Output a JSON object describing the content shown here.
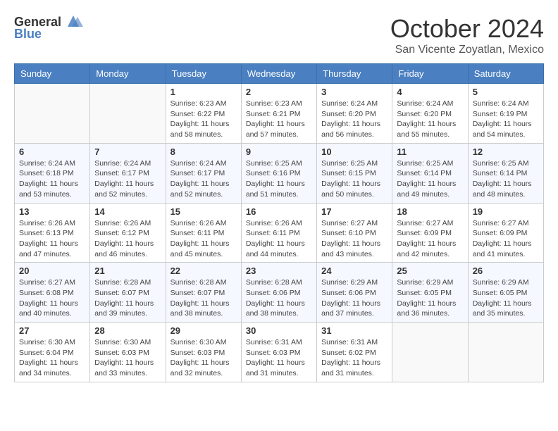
{
  "header": {
    "logo_general": "General",
    "logo_blue": "Blue",
    "month_title": "October 2024",
    "location": "San Vicente Zoyatlan, Mexico"
  },
  "calendar": {
    "days_of_week": [
      "Sunday",
      "Monday",
      "Tuesday",
      "Wednesday",
      "Thursday",
      "Friday",
      "Saturday"
    ],
    "weeks": [
      [
        {
          "day": "",
          "sunrise": "",
          "sunset": "",
          "daylight": "",
          "empty": true
        },
        {
          "day": "",
          "sunrise": "",
          "sunset": "",
          "daylight": "",
          "empty": true
        },
        {
          "day": "1",
          "sunrise": "Sunrise: 6:23 AM",
          "sunset": "Sunset: 6:22 PM",
          "daylight": "Daylight: 11 hours and 58 minutes."
        },
        {
          "day": "2",
          "sunrise": "Sunrise: 6:23 AM",
          "sunset": "Sunset: 6:21 PM",
          "daylight": "Daylight: 11 hours and 57 minutes."
        },
        {
          "day": "3",
          "sunrise": "Sunrise: 6:24 AM",
          "sunset": "Sunset: 6:20 PM",
          "daylight": "Daylight: 11 hours and 56 minutes."
        },
        {
          "day": "4",
          "sunrise": "Sunrise: 6:24 AM",
          "sunset": "Sunset: 6:20 PM",
          "daylight": "Daylight: 11 hours and 55 minutes."
        },
        {
          "day": "5",
          "sunrise": "Sunrise: 6:24 AM",
          "sunset": "Sunset: 6:19 PM",
          "daylight": "Daylight: 11 hours and 54 minutes."
        }
      ],
      [
        {
          "day": "6",
          "sunrise": "Sunrise: 6:24 AM",
          "sunset": "Sunset: 6:18 PM",
          "daylight": "Daylight: 11 hours and 53 minutes."
        },
        {
          "day": "7",
          "sunrise": "Sunrise: 6:24 AM",
          "sunset": "Sunset: 6:17 PM",
          "daylight": "Daylight: 11 hours and 52 minutes."
        },
        {
          "day": "8",
          "sunrise": "Sunrise: 6:24 AM",
          "sunset": "Sunset: 6:17 PM",
          "daylight": "Daylight: 11 hours and 52 minutes."
        },
        {
          "day": "9",
          "sunrise": "Sunrise: 6:25 AM",
          "sunset": "Sunset: 6:16 PM",
          "daylight": "Daylight: 11 hours and 51 minutes."
        },
        {
          "day": "10",
          "sunrise": "Sunrise: 6:25 AM",
          "sunset": "Sunset: 6:15 PM",
          "daylight": "Daylight: 11 hours and 50 minutes."
        },
        {
          "day": "11",
          "sunrise": "Sunrise: 6:25 AM",
          "sunset": "Sunset: 6:14 PM",
          "daylight": "Daylight: 11 hours and 49 minutes."
        },
        {
          "day": "12",
          "sunrise": "Sunrise: 6:25 AM",
          "sunset": "Sunset: 6:14 PM",
          "daylight": "Daylight: 11 hours and 48 minutes."
        }
      ],
      [
        {
          "day": "13",
          "sunrise": "Sunrise: 6:26 AM",
          "sunset": "Sunset: 6:13 PM",
          "daylight": "Daylight: 11 hours and 47 minutes."
        },
        {
          "day": "14",
          "sunrise": "Sunrise: 6:26 AM",
          "sunset": "Sunset: 6:12 PM",
          "daylight": "Daylight: 11 hours and 46 minutes."
        },
        {
          "day": "15",
          "sunrise": "Sunrise: 6:26 AM",
          "sunset": "Sunset: 6:11 PM",
          "daylight": "Daylight: 11 hours and 45 minutes."
        },
        {
          "day": "16",
          "sunrise": "Sunrise: 6:26 AM",
          "sunset": "Sunset: 6:11 PM",
          "daylight": "Daylight: 11 hours and 44 minutes."
        },
        {
          "day": "17",
          "sunrise": "Sunrise: 6:27 AM",
          "sunset": "Sunset: 6:10 PM",
          "daylight": "Daylight: 11 hours and 43 minutes."
        },
        {
          "day": "18",
          "sunrise": "Sunrise: 6:27 AM",
          "sunset": "Sunset: 6:09 PM",
          "daylight": "Daylight: 11 hours and 42 minutes."
        },
        {
          "day": "19",
          "sunrise": "Sunrise: 6:27 AM",
          "sunset": "Sunset: 6:09 PM",
          "daylight": "Daylight: 11 hours and 41 minutes."
        }
      ],
      [
        {
          "day": "20",
          "sunrise": "Sunrise: 6:27 AM",
          "sunset": "Sunset: 6:08 PM",
          "daylight": "Daylight: 11 hours and 40 minutes."
        },
        {
          "day": "21",
          "sunrise": "Sunrise: 6:28 AM",
          "sunset": "Sunset: 6:07 PM",
          "daylight": "Daylight: 11 hours and 39 minutes."
        },
        {
          "day": "22",
          "sunrise": "Sunrise: 6:28 AM",
          "sunset": "Sunset: 6:07 PM",
          "daylight": "Daylight: 11 hours and 38 minutes."
        },
        {
          "day": "23",
          "sunrise": "Sunrise: 6:28 AM",
          "sunset": "Sunset: 6:06 PM",
          "daylight": "Daylight: 11 hours and 38 minutes."
        },
        {
          "day": "24",
          "sunrise": "Sunrise: 6:29 AM",
          "sunset": "Sunset: 6:06 PM",
          "daylight": "Daylight: 11 hours and 37 minutes."
        },
        {
          "day": "25",
          "sunrise": "Sunrise: 6:29 AM",
          "sunset": "Sunset: 6:05 PM",
          "daylight": "Daylight: 11 hours and 36 minutes."
        },
        {
          "day": "26",
          "sunrise": "Sunrise: 6:29 AM",
          "sunset": "Sunset: 6:05 PM",
          "daylight": "Daylight: 11 hours and 35 minutes."
        }
      ],
      [
        {
          "day": "27",
          "sunrise": "Sunrise: 6:30 AM",
          "sunset": "Sunset: 6:04 PM",
          "daylight": "Daylight: 11 hours and 34 minutes."
        },
        {
          "day": "28",
          "sunrise": "Sunrise: 6:30 AM",
          "sunset": "Sunset: 6:03 PM",
          "daylight": "Daylight: 11 hours and 33 minutes."
        },
        {
          "day": "29",
          "sunrise": "Sunrise: 6:30 AM",
          "sunset": "Sunset: 6:03 PM",
          "daylight": "Daylight: 11 hours and 32 minutes."
        },
        {
          "day": "30",
          "sunrise": "Sunrise: 6:31 AM",
          "sunset": "Sunset: 6:03 PM",
          "daylight": "Daylight: 11 hours and 31 minutes."
        },
        {
          "day": "31",
          "sunrise": "Sunrise: 6:31 AM",
          "sunset": "Sunset: 6:02 PM",
          "daylight": "Daylight: 11 hours and 31 minutes."
        },
        {
          "day": "",
          "sunrise": "",
          "sunset": "",
          "daylight": "",
          "empty": true
        },
        {
          "day": "",
          "sunrise": "",
          "sunset": "",
          "daylight": "",
          "empty": true
        }
      ]
    ]
  }
}
